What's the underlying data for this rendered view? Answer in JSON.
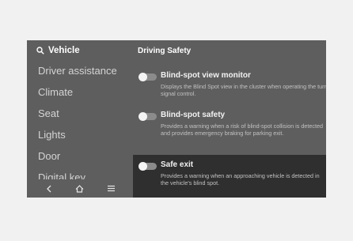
{
  "sidebar": {
    "search_label": "Vehicle",
    "items": [
      {
        "label": "Driver assistance"
      },
      {
        "label": "Climate"
      },
      {
        "label": "Seat"
      },
      {
        "label": "Lights"
      },
      {
        "label": "Door"
      },
      {
        "label": "Digital key"
      }
    ],
    "bottom_icons": [
      "back-icon",
      "home-icon",
      "menu-icon"
    ]
  },
  "main": {
    "section_title": "Driving Safety",
    "settings": [
      {
        "title": "Blind-spot view monitor",
        "description": "Displays the Blind Spot view in the cluster when operating the turn signal control.",
        "enabled": false
      },
      {
        "title": "Blind-spot safety",
        "description": "Provides a warning when a risk of blind-spot collision is detected and provides emergency braking for parking exit.",
        "enabled": false
      },
      {
        "title": "Safe exit",
        "description": "Provides a warning when an approaching vehicle is detected in the vehicle's blind spot.",
        "enabled": false,
        "highlighted": true
      }
    ]
  },
  "colors": {
    "screen_bg": "#5e5e5e",
    "highlight_bg": "#2f2f2f",
    "page_bg": "#f1f1f1"
  }
}
